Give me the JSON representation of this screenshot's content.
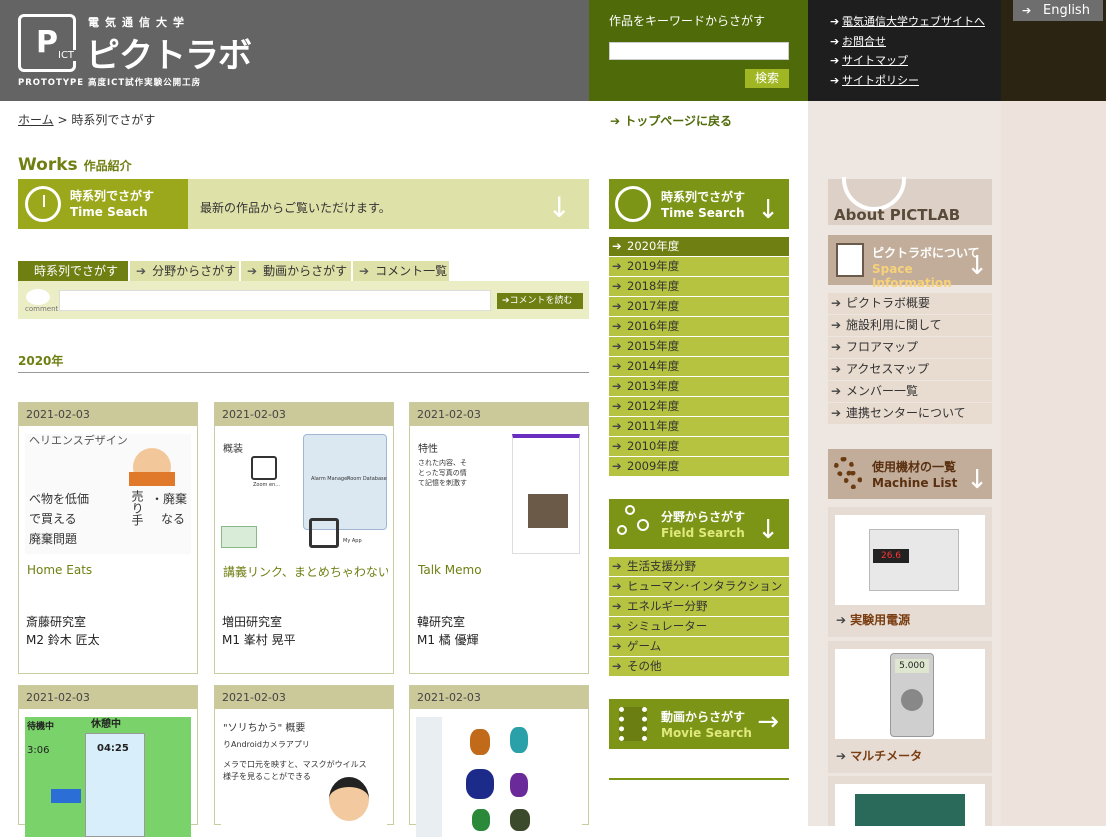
{
  "header": {
    "logo": {
      "university": "電気通信大学",
      "name": "ピクトラボ",
      "tagline": "PROTOTYPE 高度ICT試作実験公開工房",
      "mark": "P",
      "mark_sub": "ICT"
    },
    "search": {
      "label": "作品をキーワードからさがす",
      "placeholder": "",
      "button": "検索"
    },
    "links": [
      "電気通信大学ウェブサイトへ",
      "お問合せ",
      "サイトマップ",
      "サイトポリシー"
    ],
    "english": "English"
  },
  "breadcrumb": {
    "home": "ホーム",
    "sep": ">",
    "current": "時系列でさがす"
  },
  "works_heading": {
    "main": "Works",
    "sub": "作品紹介"
  },
  "banner": {
    "title_ja": "時系列でさがす",
    "title_en": "Time Seach",
    "text": "最新の作品からご覧いただけます。"
  },
  "tabs": [
    "時系列でさがす",
    "分野からさがす",
    "動画からさがす",
    "コメント一覧"
  ],
  "comment_bar": {
    "icon_label": "comment",
    "placeholder": "",
    "button": "コメントを読む"
  },
  "year_heading": "2020年",
  "cards": [
    {
      "date": "2021-02-03",
      "title": "Home Eats",
      "lab": "斎藤研究室",
      "member": "M2 鈴木 匠太"
    },
    {
      "date": "2021-02-03",
      "title": "講義リンク、まとめちゃわない？",
      "lab": "増田研究室",
      "member": "M1 峯村 晃平"
    },
    {
      "date": "2021-02-03",
      "title": "Talk Memo",
      "lab": "韓研究室",
      "member": "M1 橘 優輝"
    },
    {
      "date": "2021-02-03",
      "title": "",
      "lab": "",
      "member": ""
    },
    {
      "date": "2021-02-03",
      "title": "",
      "lab": "",
      "member": ""
    },
    {
      "date": "2021-02-03",
      "title": "",
      "lab": "",
      "member": ""
    }
  ],
  "thumbs": {
    "c1": {
      "t1": "ヘリエンスデザイン",
      "t2": "べ物を低価",
      "t3": "で買える",
      "t4": "廃棄問題",
      "t5": "・廃棄",
      "t6": "なる",
      "t7": "売り手"
    },
    "c2": {
      "t1": "概装",
      "t2": "Zoom en...",
      "t3": "Alarm Manager",
      "t4": "Room Database",
      "t5": "My App"
    },
    "c3": {
      "t1": "特性",
      "t2": "された内容、そ",
      "t3": "とった写真の情",
      "t4": "て記憶を刺激す"
    },
    "c4": {
      "t1": "待機中",
      "t2": "休憩中",
      "t3": "04:25",
      "t4": "3:06"
    },
    "c5": {
      "t1": "\"ソリちかう\" 概要",
      "t2": "りAndroidカメラアプリ",
      "t3": "メラで口元を映すと、マスクがウイルス",
      "t4": "様子を見ることができる"
    }
  },
  "mid": {
    "top_link": "トップページに戻る",
    "time": {
      "ja": "時系列でさがす",
      "en": "Time Search"
    },
    "years": [
      "2020年度",
      "2019年度",
      "2018年度",
      "2017年度",
      "2016年度",
      "2015年度",
      "2014年度",
      "2013年度",
      "2012年度",
      "2011年度",
      "2010年度",
      "2009年度"
    ],
    "selected_year": "2020年度",
    "field": {
      "ja": "分野からさがす",
      "en": "Field Search"
    },
    "fields": [
      "生活支援分野",
      "ヒューマン･インタラクション",
      "エネルギー分野",
      "シミュレーター",
      "ゲーム",
      "その他"
    ],
    "movie": {
      "ja": "動画からさがす",
      "en": "Movie Search"
    }
  },
  "right": {
    "about": "About PICTLAB",
    "space": {
      "ja": "ピクトラボについて",
      "en": "Space Information"
    },
    "space_items": [
      "ピクトラボ概要",
      "施設利用に関して",
      "フロアマップ",
      "アクセスマップ",
      "メンバー一覧",
      "連携センターについて"
    ],
    "machine": {
      "ja": "使用機材の一覧",
      "en": "Machine List"
    },
    "machines": [
      {
        "name": "実験用電源",
        "display": "26.6"
      },
      {
        "name": "マルチメータ",
        "display": "5.000"
      }
    ]
  },
  "colors": {
    "olive": "#6f7f12",
    "dark_green": "#4f6a08",
    "header_gray": "#646464",
    "tan": "#cbb9a7",
    "brown_text": "#7a3d12"
  },
  "icons": [
    "search-icon",
    "arrow-right-icon",
    "clock-icon",
    "down-arrow-icon",
    "comment-icon",
    "gear-icon",
    "film-icon",
    "share-nodes-icon"
  ]
}
